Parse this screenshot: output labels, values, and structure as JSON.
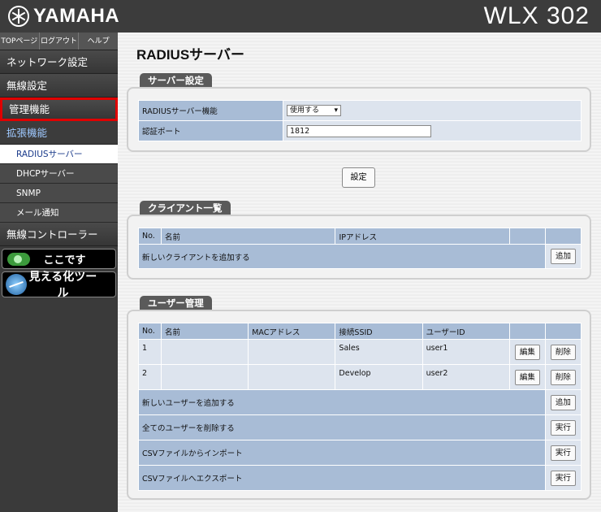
{
  "header": {
    "brand": "YAMAHA",
    "model": "WLX 302"
  },
  "sidebar": {
    "top_links": [
      "TOPページ",
      "ログアウト",
      "ヘルプ"
    ],
    "items": [
      {
        "label": "ネットワーク設定"
      },
      {
        "label": "無線設定"
      },
      {
        "label": "管理機能"
      },
      {
        "label": "拡張機能"
      }
    ],
    "sub_items": [
      "RADIUSサーバー",
      "DHCPサーバー",
      "SNMP",
      "メール通知"
    ],
    "wireless_controller": "無線コントローラー",
    "here_button": "ここです",
    "visualize_button": "見える化ツール"
  },
  "page": {
    "title": "RADIUSサーバー"
  },
  "server_settings": {
    "tab": "サーバー設定",
    "rows": [
      {
        "label": "RADIUSサーバー機能",
        "value": "使用する"
      },
      {
        "label": "認証ポート",
        "value": "1812"
      }
    ],
    "set_button": "設定"
  },
  "clients": {
    "tab": "クライアント一覧",
    "headers": [
      "No.",
      "名前",
      "IPアドレス"
    ],
    "add_label": "新しいクライアントを追加する",
    "add_button": "追加"
  },
  "users": {
    "tab": "ユーザー管理",
    "headers": [
      "No.",
      "名前",
      "MACアドレス",
      "接続SSID",
      "ユーザーID"
    ],
    "rows": [
      {
        "no": "1",
        "name": "",
        "mac": "",
        "ssid": "Sales",
        "user_id": "user1",
        "edit": "編集",
        "delete": "削除"
      },
      {
        "no": "2",
        "name": "",
        "mac": "",
        "ssid": "Develop",
        "user_id": "user2",
        "edit": "編集",
        "delete": "削除"
      }
    ],
    "actions": [
      {
        "label": "新しいユーザーを追加する",
        "button": "追加"
      },
      {
        "label": "全てのユーザーを削除する",
        "button": "実行"
      },
      {
        "label": "CSVファイルからインポート",
        "button": "実行"
      },
      {
        "label": "CSVファイルへエクスポート",
        "button": "実行"
      }
    ]
  }
}
